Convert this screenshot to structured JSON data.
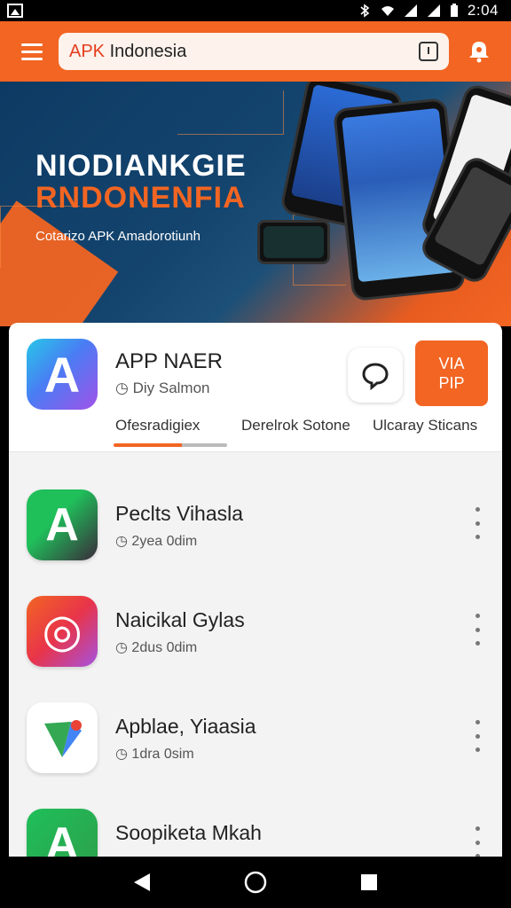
{
  "status_bar": {
    "time": "2:04"
  },
  "toolbar": {
    "search_prefix": "APK",
    "search_rest": " Indonesia"
  },
  "banner": {
    "title_line1": "NIODIANKGIE",
    "title_line2": "RNDONENFIA",
    "subtitle": "Cotarizo APK Amadorotiunh"
  },
  "featured": {
    "name": "APP NAER",
    "meta": "Diy Salmon",
    "action_text_line1": "VIA",
    "action_text_line2": "PIP"
  },
  "tabs": [
    {
      "label": "Ofesradigiex"
    },
    {
      "label": "Derelrok Sotone"
    },
    {
      "label": "Ulcaray Sticans"
    }
  ],
  "apps": [
    {
      "name": "Peclts Vihasla",
      "meta": "2yea  0dim",
      "icon_letter": "A",
      "icon_colors": [
        "#1fbf5a",
        "#3a2a3a"
      ]
    },
    {
      "name": "Naicikal Gylas",
      "meta": "2dus  0dim",
      "icon_letter": "◎",
      "icon_colors": [
        "#f26522",
        "#a552e0"
      ]
    },
    {
      "name": "Apblae, Yiaasia",
      "meta": "1dra  0sim",
      "icon_letter": "▶",
      "icon_colors": [
        "#ffffff",
        "#ffffff"
      ]
    },
    {
      "name": "Soopiketa Mkah",
      "meta": "",
      "icon_letter": "A",
      "icon_colors": [
        "#1fbf5a",
        "#2e9e4a"
      ]
    }
  ],
  "colors": {
    "accent": "#f26522",
    "banner_dark": "#0d3a63"
  }
}
